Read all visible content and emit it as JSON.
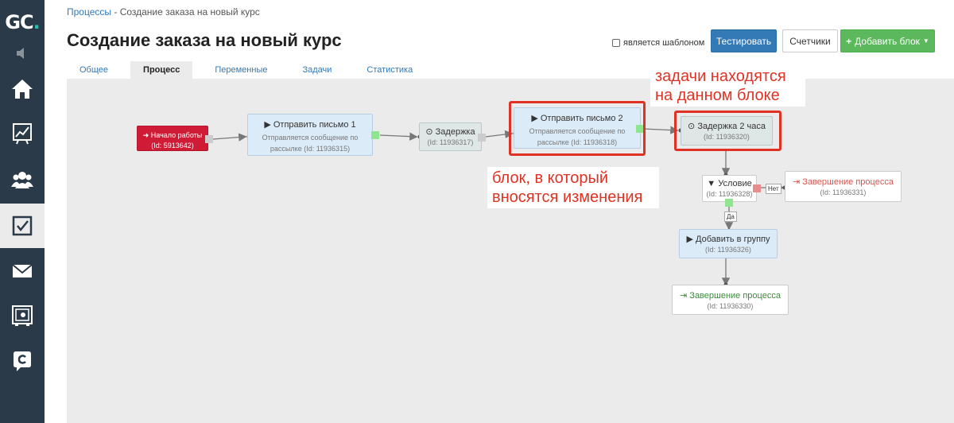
{
  "logo": {
    "text": "GC",
    "dot": "."
  },
  "breadcrumb": {
    "link": "Процессы",
    "separator": " - ",
    "current": "Создание заказа на новый курс"
  },
  "page_title": "Создание заказа на новый курс",
  "header": {
    "template_label": "является шаблоном",
    "test_button": "Тестировать",
    "counters_button": "Счетчики",
    "add_block_button": "Добавить блок"
  },
  "tabs": [
    {
      "label": "Общее"
    },
    {
      "label": "Процесс"
    },
    {
      "label": "Переменные"
    },
    {
      "label": "Задачи"
    },
    {
      "label": "Статистика"
    }
  ],
  "nodes": {
    "start": {
      "title": "Начало работы",
      "id": "(Id: 5913642)"
    },
    "email1": {
      "title": "Отправить письмо 1",
      "subtitle": "Отправляется сообщение по рассылке (Id: 11936315)"
    },
    "delay1": {
      "title": "Задержка",
      "id": "(Id: 11936317)"
    },
    "email2": {
      "title": "Отправить письмо 2",
      "subtitle": "Отправляется сообщение по рассылке (Id: 11936318)"
    },
    "delay2": {
      "title": "Задержка 2 часа",
      "id": "(Id: 11936320)"
    },
    "condition": {
      "title": "Условие",
      "id": "(Id: 11936328)"
    },
    "end_no": {
      "title": "Завершение процесса",
      "id": "(Id: 11936331)"
    },
    "add_group": {
      "title": "Добавить в группу",
      "id": "(Id: 11936326)"
    },
    "end_yes": {
      "title": "Завершение процесса",
      "id": "(Id: 11936330)"
    }
  },
  "branch_labels": {
    "no": "Нет",
    "yes": "Да"
  },
  "annotations": {
    "tasks_here": "задачи находятся на данном блоке",
    "block_changed": "блок, в который вносятся изменения"
  },
  "colors": {
    "sidebar": "#2b3a48",
    "accent_blue": "#337ab7",
    "accent_green": "#5cb85c",
    "start_red": "#d01b36",
    "annotation_red": "#e03224",
    "end_red": "#d9534f",
    "end_green": "#3c8b3c"
  },
  "icons": [
    "home-icon",
    "chart-icon",
    "users-icon",
    "tasks-icon",
    "mail-icon",
    "safe-icon",
    "chat-icon",
    "speaker-icon",
    "play-icon",
    "clock-icon",
    "filter-icon",
    "sign-out-icon",
    "sign-in-icon",
    "plus-icon",
    "caret-down-icon"
  ]
}
